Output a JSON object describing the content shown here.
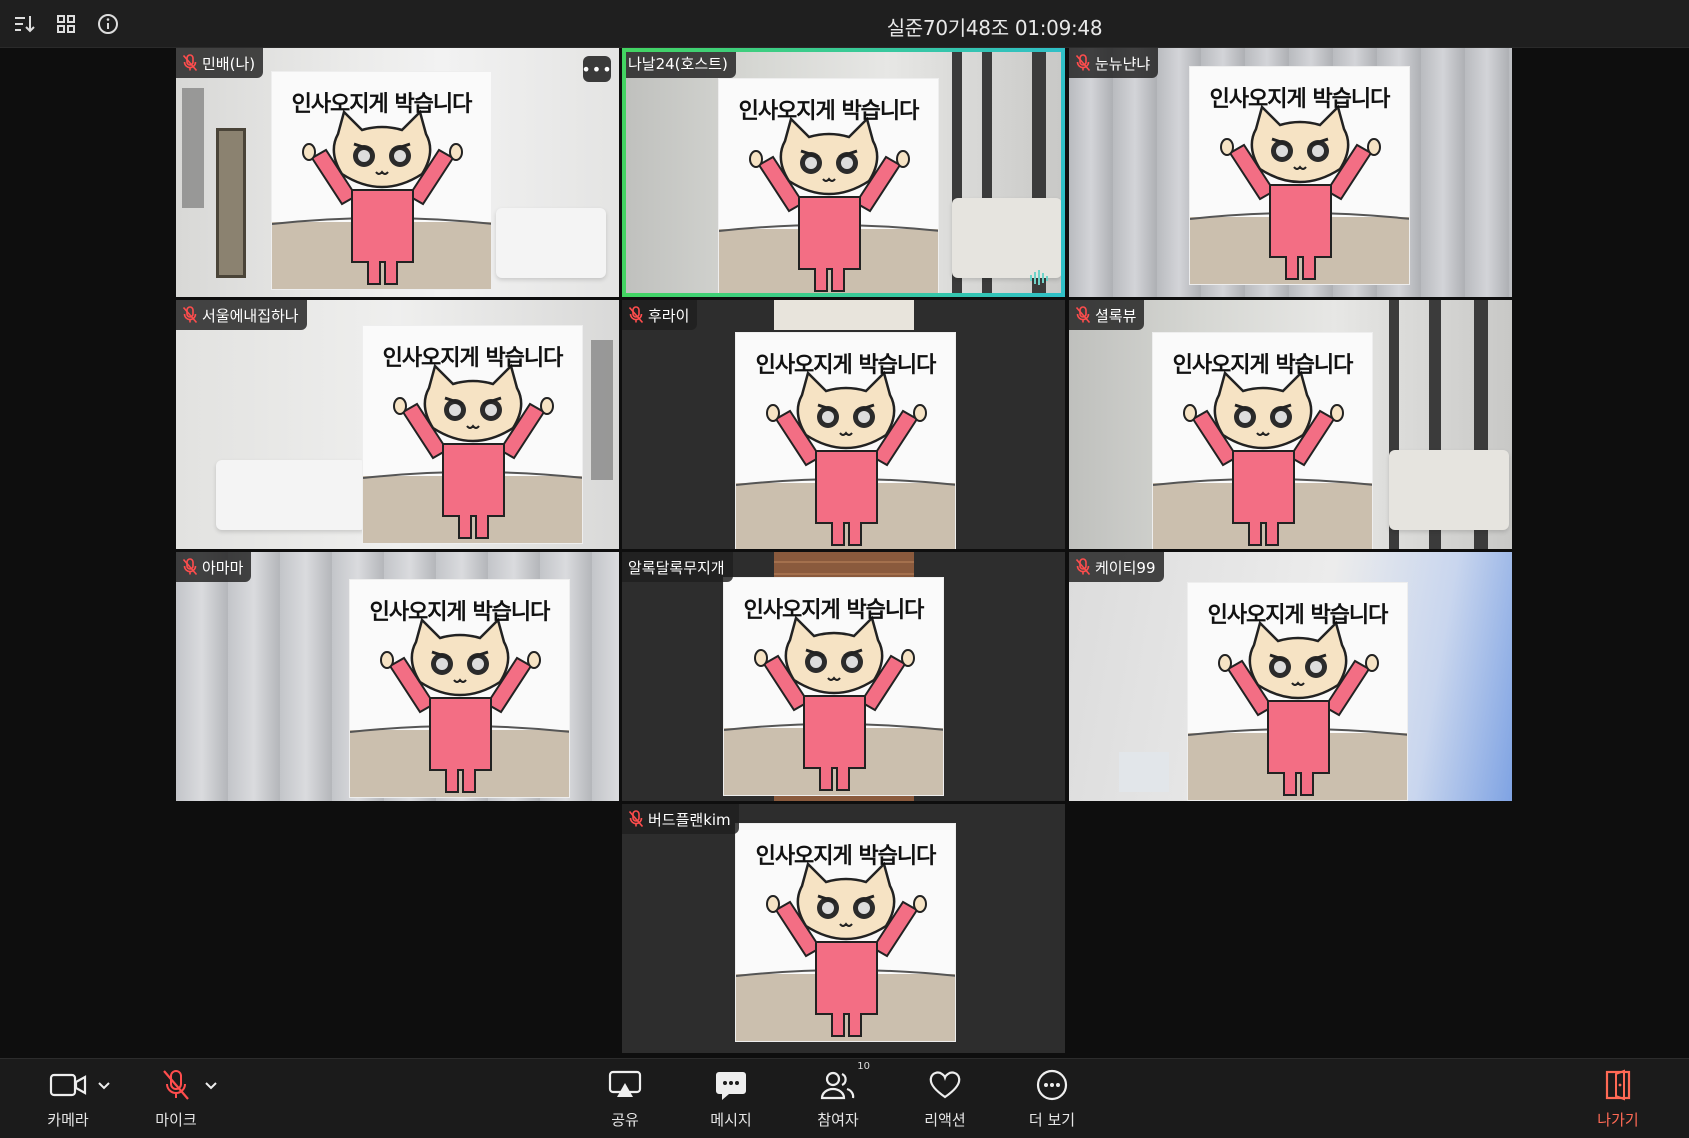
{
  "meeting": {
    "title": "실준70기48조 01:09:48"
  },
  "topbar_icons": [
    "sort-icon",
    "grid-view-icon",
    "info-icon"
  ],
  "sticker": {
    "caption": "인사오지게 박습니다"
  },
  "participants": [
    {
      "name": "민배(나)",
      "muted": true
    },
    {
      "name": "나날24(호스트)",
      "muted": false,
      "active_speaker": true
    },
    {
      "name": "눈뉴냔냐",
      "muted": true
    },
    {
      "name": "서울에내집하나",
      "muted": true
    },
    {
      "name": "후라이",
      "muted": true
    },
    {
      "name": "셜록뷰",
      "muted": true
    },
    {
      "name": "아마마",
      "muted": true
    },
    {
      "name": "알록달록무지개",
      "muted": false
    },
    {
      "name": "케이티99",
      "muted": true
    },
    {
      "name": "버드플랜kim",
      "muted": true
    }
  ],
  "toolbar": {
    "camera": "카메라",
    "mic": "마이크",
    "share": "공유",
    "message": "메시지",
    "participants": "참여자",
    "participants_count": "10",
    "reaction": "리액션",
    "more": "더 보기",
    "leave": "나가기"
  },
  "colors": {
    "accent_active": "#43d462",
    "leave": "#ff6a55",
    "mute": "#ff4d4d"
  }
}
